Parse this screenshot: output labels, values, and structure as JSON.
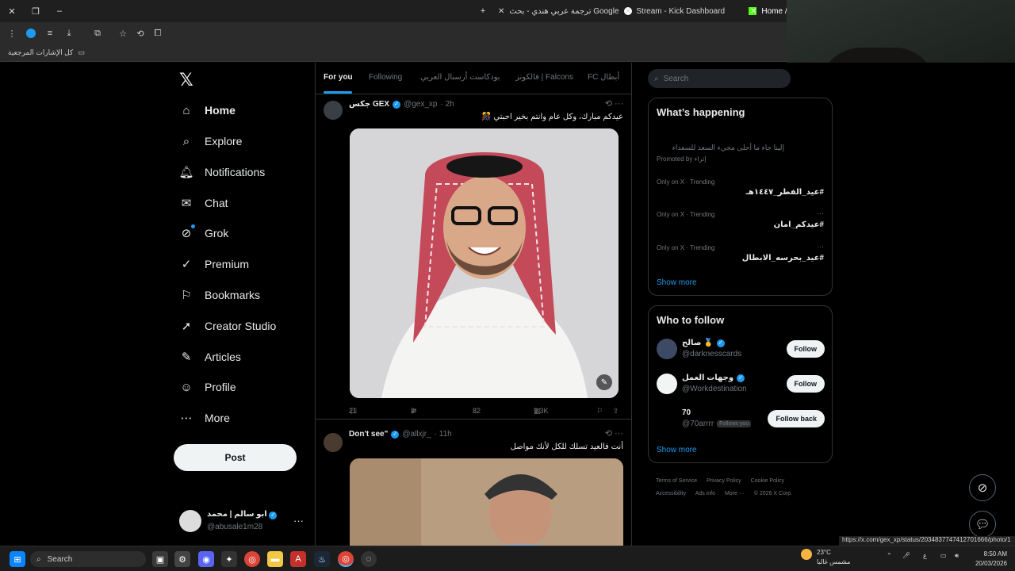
{
  "browser": {
    "tabs": [
      {
        "label": "ترجمة عربي هندي - بحث Google",
        "active": false
      },
      {
        "label": "Stream - Kick Dashboard",
        "active": false
      },
      {
        "label": "Home / X",
        "active": true
      }
    ],
    "new_tab": "+",
    "bookmarks_label": "كل الإشارات المرجعية",
    "status_url": "https://x.com/gex_xp/status/2034837747412701666/photo/1"
  },
  "nav": {
    "items": [
      {
        "label": "Home",
        "icon": "home-icon"
      },
      {
        "label": "Explore",
        "icon": "search-icon"
      },
      {
        "label": "Notifications",
        "icon": "bell-icon"
      },
      {
        "label": "Chat",
        "icon": "mail-icon"
      },
      {
        "label": "Grok",
        "icon": "grok-icon"
      },
      {
        "label": "Premium",
        "icon": "premium-icon"
      },
      {
        "label": "Bookmarks",
        "icon": "bookmark-icon"
      },
      {
        "label": "Creator Studio",
        "icon": "rocket-icon"
      },
      {
        "label": "Articles",
        "icon": "article-icon"
      },
      {
        "label": "Profile",
        "icon": "user-icon"
      },
      {
        "label": "More",
        "icon": "more-icon"
      }
    ],
    "post_label": "Post",
    "account": {
      "name": "ابو سالم | محمد",
      "handle": "@abusale1m28"
    }
  },
  "feed": {
    "tabs": [
      "For you",
      "Following",
      "بودكاست أرسنال العربي",
      "فالكونز | Falcons",
      "FC أبطال"
    ],
    "tweets": [
      {
        "name": "جكس GEX",
        "handle": "@gex_xp",
        "time": "· 2h",
        "text": "عيدكم مبارك، وكل عام وانتم بخير احبتي 🎊",
        "replies": "21",
        "reposts": "3",
        "likes": "82",
        "views": "9.3K"
      },
      {
        "name": "Don't see\"",
        "handle": "@allxjr_",
        "time": "· 11h",
        "text": "أنت فالعيد تسلك للكل لأنك مواصل"
      }
    ]
  },
  "sidebar": {
    "search_placeholder": "Search",
    "happening": {
      "title": "What’s happening",
      "promo_text": "إلينا جاء ما أحلى مجيء السعد للسعداء",
      "promo_by": "Promoted by إثراء",
      "trends": [
        {
          "meta": "Only on X · Trending",
          "name": "#عيد_الفطر_١٤٤٧هـ"
        },
        {
          "meta": "Only on X · Trending",
          "name": "#عيدكم_امان"
        },
        {
          "meta": "Only on X · Trending",
          "name": "#عيد_بحرسه_الابطال"
        }
      ],
      "show_more": "Show more"
    },
    "who_to_follow": {
      "title": "Who to follow",
      "accounts": [
        {
          "name": "صالح 🥇",
          "handle": "@darknesscards",
          "button": "Follow",
          "follows_you": ""
        },
        {
          "name": "وجهات العمل",
          "handle": "@Workdestination",
          "button": "Follow",
          "follows_you": ""
        },
        {
          "name": "70",
          "handle": "@70arrrr",
          "button": "Follow back",
          "follows_you": "Follows you"
        }
      ],
      "show_more": "Show more"
    },
    "footer": [
      "Terms of Service",
      "Privacy Policy",
      "Cookie Policy",
      "Accessibility",
      "Ads info",
      "More ···",
      "© 2026 X Corp."
    ]
  },
  "taskbar": {
    "search": "Search",
    "weather_temp": "23°C",
    "weather_desc": "مشمس غالبا",
    "time": "8:50 AM",
    "date": "20/03/2026",
    "lang": "ع"
  },
  "colors": {
    "accent": "#1d9bf0",
    "background": "#000000",
    "border": "#2f3336",
    "muted": "#71767b"
  }
}
